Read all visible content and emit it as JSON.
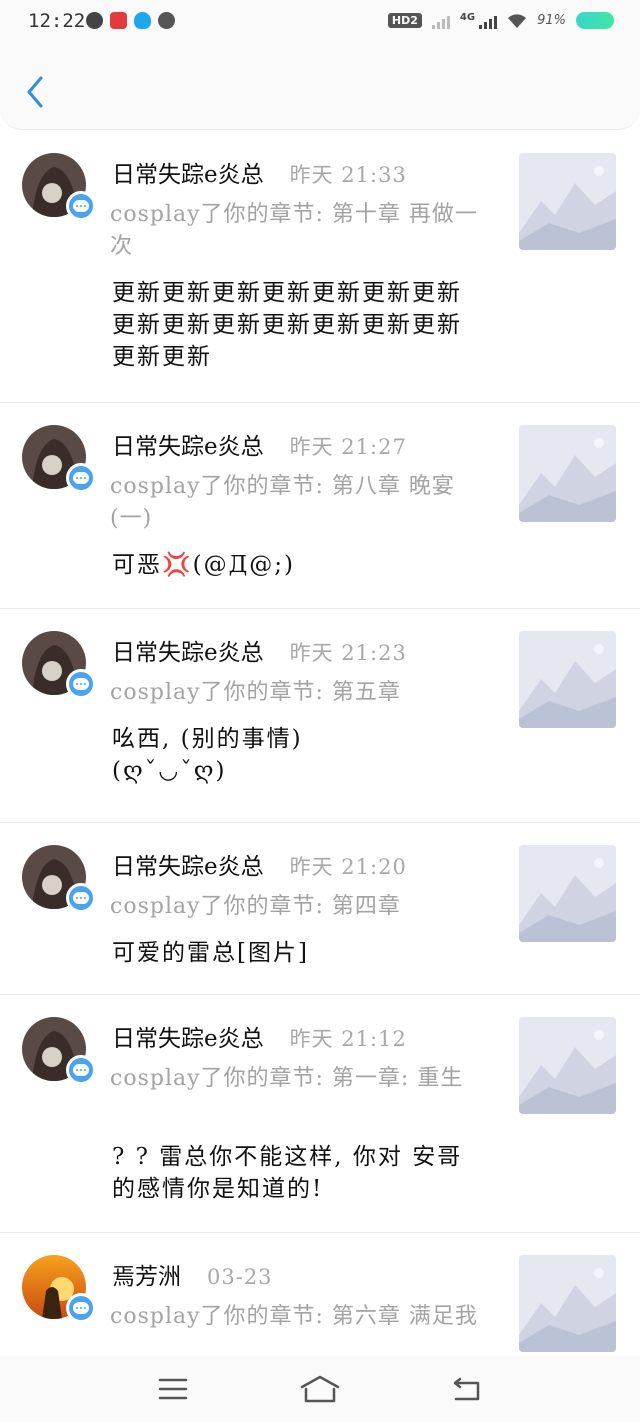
{
  "status_bar": {
    "time": "12:22",
    "hd_label": "HD2",
    "network_label": "4G",
    "battery_text": "91%",
    "accent_battery": "#3fe6a6"
  },
  "header": {
    "back_icon": "chevron-left-icon",
    "accent": "#2d8fe0"
  },
  "messages": [
    {
      "name": "日常失踪e炎总",
      "time": "昨天 21:33",
      "ref": "cosplay了你的章节: 第十章 再做一次",
      "content": "更新更新更新更新更新更新更新更新更新更新更新更新更新更新更新更新"
    },
    {
      "name": "日常失踪e炎总",
      "time": "昨天 21:27",
      "ref": "cosplay了你的章节: 第八章 晚宴 (一)",
      "content": "可恶💢(@Д@;)"
    },
    {
      "name": "日常失踪e炎总",
      "time": "昨天 21:23",
      "ref": "cosplay了你的章节: 第五章",
      "content": "吆西, (别的事情) (ღˇ◡ˇღ)"
    },
    {
      "name": "日常失踪e炎总",
      "time": "昨天 21:20",
      "ref": "cosplay了你的章节: 第四章",
      "content": "可爱的雷总[图片]"
    },
    {
      "name": "日常失踪e炎总",
      "time": "昨天 21:12",
      "ref": "cosplay了你的章节: 第一章: 重生",
      "content": "? ? 雷总你不能这样, 你对 安哥的感情你是知道的!"
    },
    {
      "name": "焉芳洲",
      "time": "03-23",
      "ref": "cosplay了你的章节: 第六章 满足我",
      "content": ""
    }
  ],
  "nav": {
    "menu_icon": "menu-icon",
    "home_icon": "home-icon",
    "back_icon": "back-icon"
  }
}
